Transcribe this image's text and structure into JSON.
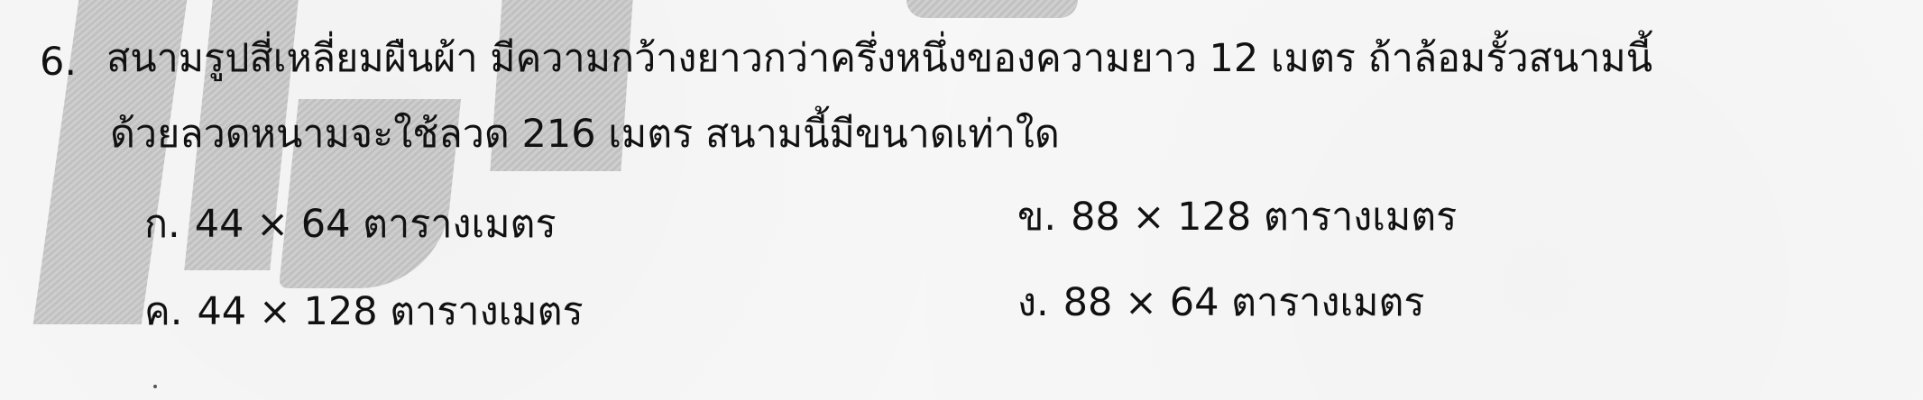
{
  "question": {
    "number": "6.",
    "line1": "สนามรูปสี่เหลี่ยมผืนผ้า มีความกว้างยาวกว่าครึ่งหนึ่งของความยาว 12 เมตร ถ้าล้อมรั้วสนามนี้",
    "line2": "ด้วยลวดหนามจะใช้ลวด 216 เมตร สนามนี้มีขนาดเท่าใด"
  },
  "choices": [
    {
      "label": "ก.",
      "text": "44 × 64 ตารางเมตร"
    },
    {
      "label": "ข.",
      "text": "88 × 128 ตารางเมตร"
    },
    {
      "label": "ค.",
      "text": "44 × 128 ตารางเมตร"
    },
    {
      "label": "ง.",
      "text": "88 × 64 ตารางเมตร"
    }
  ]
}
